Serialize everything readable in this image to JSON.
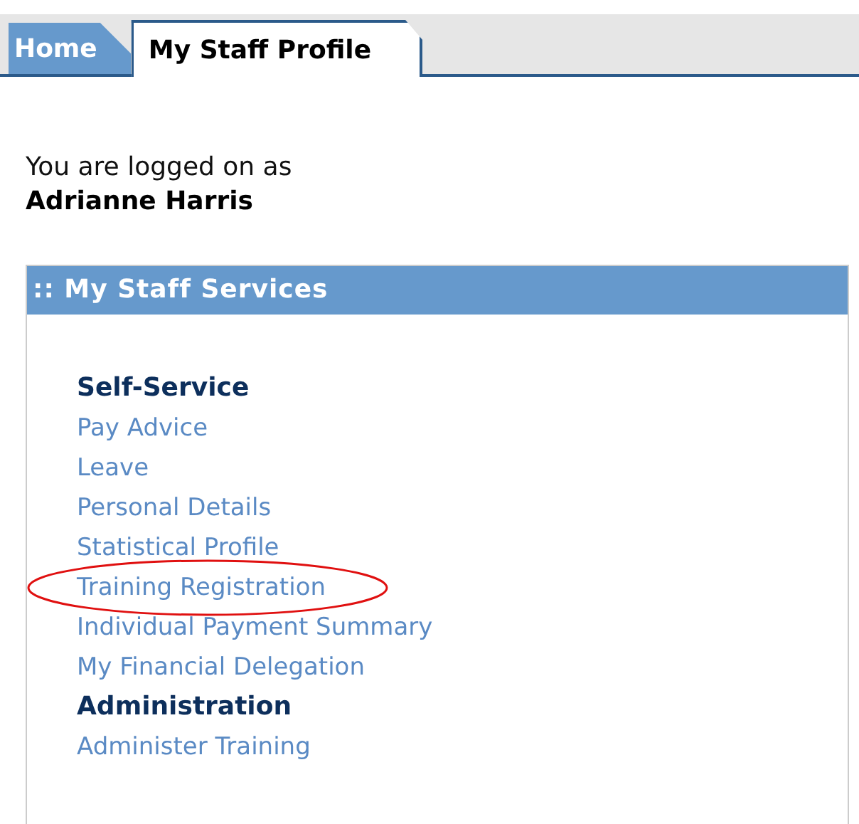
{
  "tabs": [
    {
      "label": "Home",
      "selected": false
    },
    {
      "label": "My Staff Profile",
      "selected": true
    }
  ],
  "login": {
    "caption": "You are logged on as",
    "user": "Adrianne Harris"
  },
  "panel": {
    "title": ":: My Staff Services",
    "items": [
      {
        "kind": "heading",
        "label": "Self-Service",
        "circled": false
      },
      {
        "kind": "link",
        "label": "Pay Advice",
        "circled": false
      },
      {
        "kind": "link",
        "label": "Leave",
        "circled": false
      },
      {
        "kind": "link",
        "label": "Personal Details",
        "circled": false
      },
      {
        "kind": "link",
        "label": "Statistical Profile",
        "circled": false
      },
      {
        "kind": "link",
        "label": "Training Registration",
        "circled": true
      },
      {
        "kind": "link",
        "label": "Individual Payment Summary",
        "circled": false
      },
      {
        "kind": "link",
        "label": "My Financial Delegation",
        "circled": false
      },
      {
        "kind": "heading",
        "label": "Administration",
        "circled": false
      },
      {
        "kind": "link",
        "label": "Administer Training",
        "circled": false
      }
    ]
  }
}
